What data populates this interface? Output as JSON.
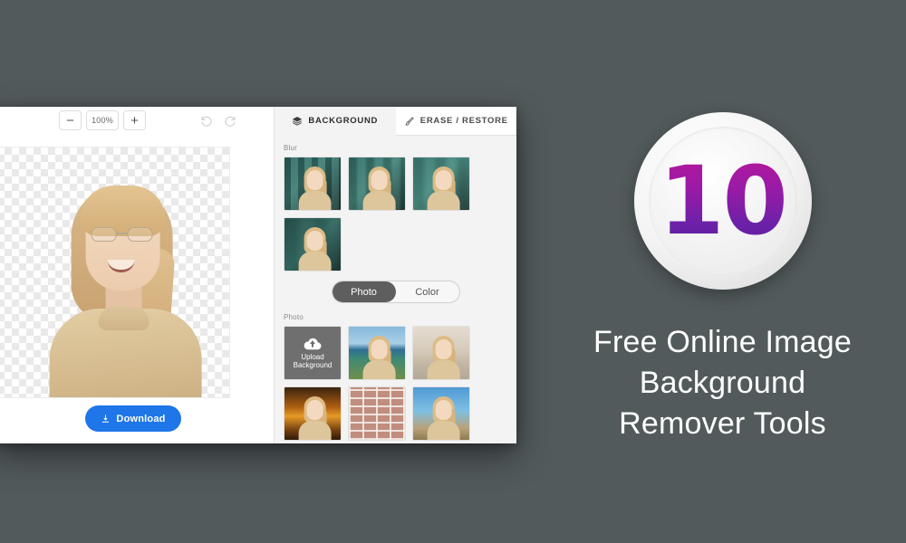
{
  "page": {
    "background_color": "#525a5c"
  },
  "app": {
    "toolbar": {
      "zoom_out_label": "−",
      "zoom_level": "100%",
      "zoom_in_label": "+",
      "undo_icon": "undo-icon",
      "redo_icon": "redo-icon"
    },
    "canvas": {
      "description": "cut-out portrait on transparency checkerboard"
    },
    "download": {
      "label": "Download",
      "icon": "download-icon",
      "color": "#1e76e8"
    },
    "tabs": [
      {
        "label": "BACKGROUND",
        "icon": "layers-icon",
        "active": true
      },
      {
        "label": "ERASE / RESTORE",
        "icon": "brush-icon",
        "active": false
      }
    ],
    "panel": {
      "blur_section_label": "Blur",
      "blur_thumbs": [
        {
          "name": "blur-level-1"
        },
        {
          "name": "blur-level-2"
        },
        {
          "name": "blur-level-3"
        },
        {
          "name": "blur-level-4"
        }
      ],
      "toggle": {
        "options": [
          "Photo",
          "Color"
        ],
        "selected": "Photo"
      },
      "photo_section_label": "Photo",
      "photo_thumbs": [
        {
          "name": "upload-background",
          "label_line1": "Upload",
          "label_line2": "Background",
          "icon": "cloud-upload-icon"
        },
        {
          "name": "background-beach"
        },
        {
          "name": "background-cafe"
        },
        {
          "name": "background-sunset"
        },
        {
          "name": "background-brick"
        },
        {
          "name": "background-palms"
        }
      ]
    }
  },
  "promo": {
    "badge_number": "10",
    "title_line1": "Free Online Image",
    "title_line2": "Background",
    "title_line3": "Remover Tools"
  }
}
